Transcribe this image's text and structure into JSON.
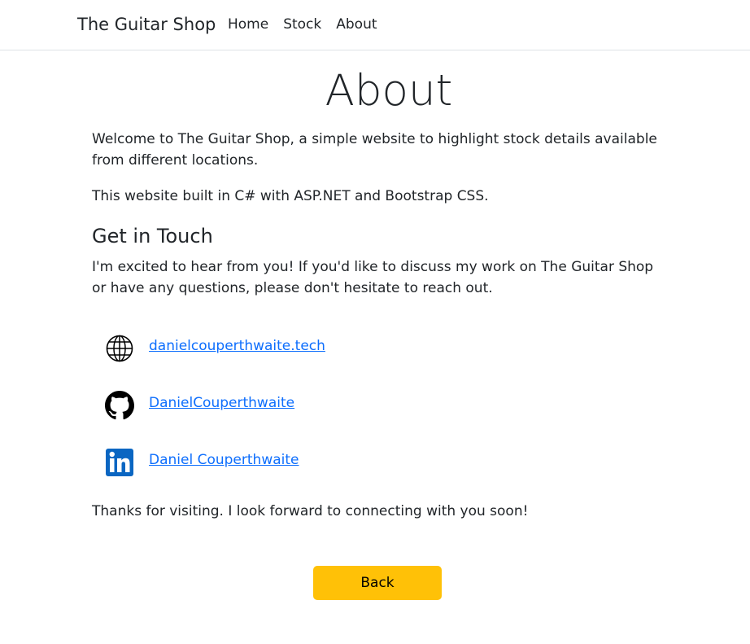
{
  "navbar": {
    "brand": "The Guitar Shop",
    "links": [
      "Home",
      "Stock",
      "About"
    ]
  },
  "page": {
    "title": "About",
    "intro": "Welcome to The Guitar Shop, a simple website to highlight stock details available from different locations.",
    "built": "This website built in C# with ASP.NET and Bootstrap CSS.",
    "section_title": "Get in Touch",
    "touch_text": "I'm excited to hear from you! If you'd like to discuss my work on The Guitar Shop or have any questions, please don't hesitate to reach out.",
    "thanks": "Thanks for visiting. I look forward to connecting with you soon!"
  },
  "contacts": [
    {
      "icon": "globe-icon",
      "label": "danielcouperthwaite.tech"
    },
    {
      "icon": "github-icon",
      "label": "DanielCouperthwaite"
    },
    {
      "icon": "linkedin-icon",
      "label": "Daniel Couperthwaite"
    }
  ],
  "actions": {
    "back_label": "Back"
  },
  "colors": {
    "link": "#0d6efd",
    "back_button": "#ffc107",
    "linkedin": "#0a66c2"
  }
}
